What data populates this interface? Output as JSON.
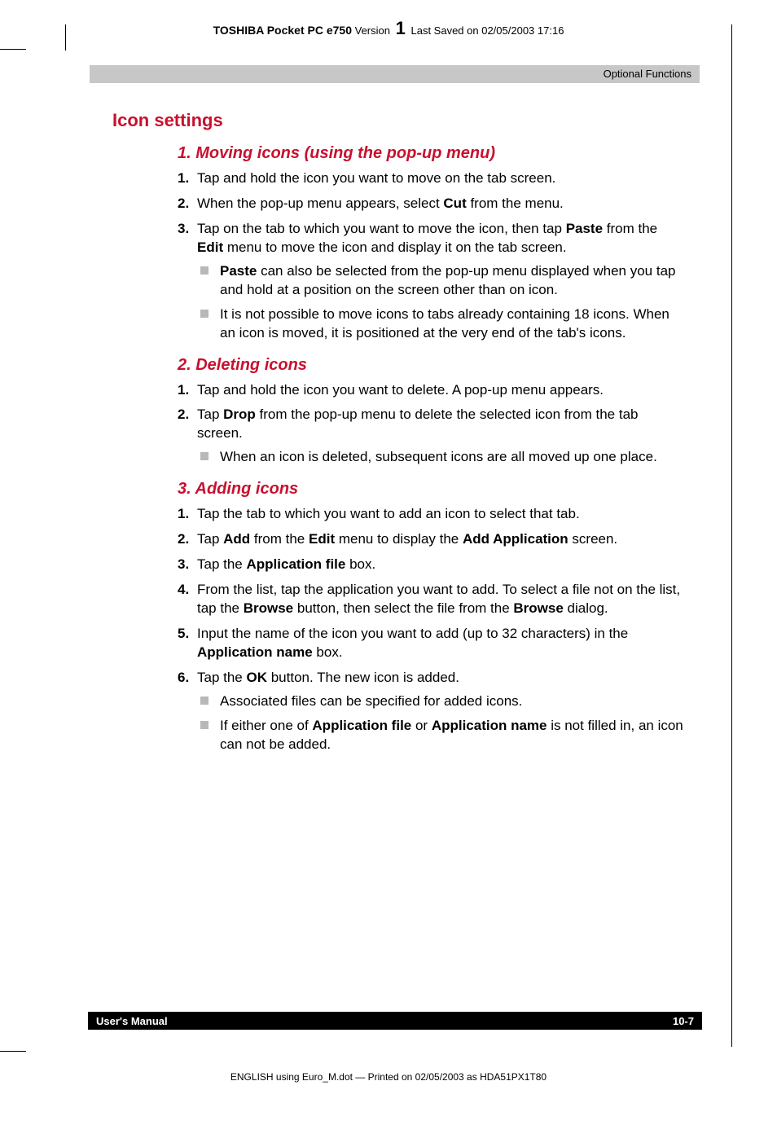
{
  "header": {
    "product": "TOSHIBA Pocket PC e750",
    "version_label": "Version",
    "version_num": "1",
    "saved": "Last Saved on 02/05/2003 17:16"
  },
  "chapter_band": "Optional Functions",
  "section_title": "Icon settings",
  "sub1": {
    "title": "1. Moving icons (using the pop-up menu)",
    "steps": [
      {
        "n": "1.",
        "text": "Tap and hold the icon you want to move on the tab screen."
      },
      {
        "n": "2.",
        "pre": "When the pop-up menu appears, select ",
        "b1": "Cut",
        "post": " from the menu."
      },
      {
        "n": "3.",
        "pre": "Tap on the tab to which you want to move the icon, then tap ",
        "b1": "Paste",
        "mid": " from the ",
        "b2": "Edit",
        "post": " menu to move the icon and display it on the tab screen."
      }
    ],
    "bullets": [
      {
        "b": "Paste",
        "text": " can also be selected from the pop-up menu displayed when you tap and hold at a position on the screen other than on icon."
      },
      {
        "text": "It is not possible to move icons to tabs already containing 18 icons. When an icon is moved, it is positioned at the very end of the tab's icons."
      }
    ]
  },
  "sub2": {
    "title": "2. Deleting icons",
    "steps": [
      {
        "n": "1.",
        "text": "Tap and hold the icon you want to delete. A pop-up menu appears."
      },
      {
        "n": "2.",
        "pre": "Tap ",
        "b1": "Drop",
        "post": " from the pop-up menu to delete the selected icon from the tab screen."
      }
    ],
    "bullets": [
      {
        "text": "When an icon is deleted, subsequent icons are all moved up one place."
      }
    ]
  },
  "sub3": {
    "title": "3. Adding icons",
    "steps": [
      {
        "n": "1.",
        "text": "Tap the tab to which you want to add an icon to select that tab."
      },
      {
        "n": "2.",
        "pre": "Tap ",
        "b1": "Add",
        "mid": " from the ",
        "b2": "Edit",
        "mid2": " menu to display the ",
        "b3": "Add Application",
        "post": " screen."
      },
      {
        "n": "3.",
        "pre": "Tap the ",
        "b1": "Application file",
        "post": " box."
      },
      {
        "n": "4.",
        "pre": "From the list, tap the application you want to add. To select a file not on the list, tap the ",
        "b1": "Browse",
        "mid": " button, then select the file from the ",
        "b2": "Browse",
        "post": " dialog."
      },
      {
        "n": "5.",
        "pre": "Input the name of the icon you want to add (up to 32 characters) in the ",
        "b1": "Application name",
        "post": " box."
      },
      {
        "n": "6.",
        "pre": "Tap the ",
        "b1": "OK",
        "post": " button. The new icon is added."
      }
    ],
    "bullets": [
      {
        "text": "Associated files can be specified for added icons."
      },
      {
        "pre": "If either one of ",
        "b1": "Application file",
        "mid": " or ",
        "b2": "Application name",
        "post": " is not filled in, an icon can not be added."
      }
    ]
  },
  "footer": {
    "left": "User's Manual",
    "right": "10-7"
  },
  "footer_print": "ENGLISH using Euro_M.dot — Printed on 02/05/2003 as HDA51PX1T80"
}
